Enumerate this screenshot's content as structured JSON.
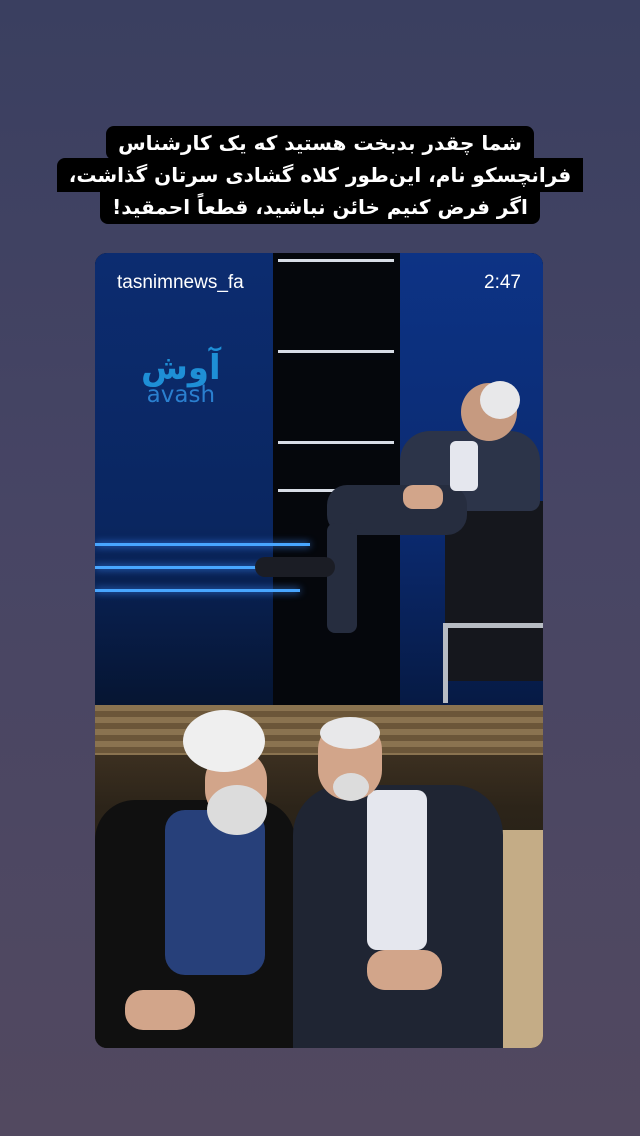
{
  "caption": {
    "lines": [
      "شما چقدر بدبخت هستید که یک کارشناس",
      "فرانچسکو نام، این‌طور کلاه گشادی سرتان گذاشت،",
      "اگر فرض کنیم خائن نباشید، قطعاً احمقید!"
    ]
  },
  "video": {
    "channel": "tasnimnews_fa",
    "timestamp": "2:47",
    "logo_fa": "آوش",
    "logo_en": "avash"
  }
}
